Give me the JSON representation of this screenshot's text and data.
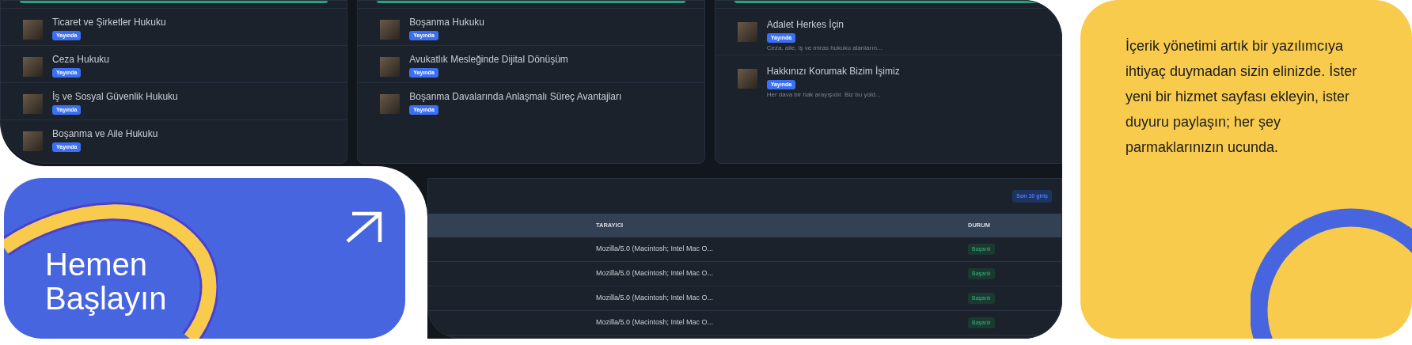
{
  "content_cards": [
    {
      "items": [
        {
          "title": "Ticaret ve Şirketler Hukuku",
          "status": "Yayında"
        },
        {
          "title": "Ceza Hukuku",
          "status": "Yayında"
        },
        {
          "title": "İş ve Sosyal Güvenlik Hukuku",
          "status": "Yayında"
        },
        {
          "title": "Boşanma ve Aile Hukuku",
          "status": "Yayında"
        }
      ]
    },
    {
      "items": [
        {
          "title": "Boşanma Hukuku",
          "status": "Yayında"
        },
        {
          "title": "Avukatlık Mesleğinde Dijital Dönüşüm",
          "status": "Yayında"
        },
        {
          "title": "Boşanma Davalarında Anlaşmalı Süreç Avantajları",
          "status": "Yayında"
        }
      ]
    },
    {
      "items": [
        {
          "title": "Adalet Herkes İçin",
          "status": "Yayında",
          "excerpt": "Ceza, aile, iş ve miras hukuku alanların..."
        },
        {
          "title": "Hakkınızı Korumak Bizim İşimiz",
          "status": "Yayında",
          "excerpt": "Her dava bir hak arayışıdır. Biz bu yold..."
        }
      ]
    }
  ],
  "login_table": {
    "badge": "Son 10 giriş",
    "columns": [
      "TARAYICI",
      "DURUM"
    ],
    "rows": [
      {
        "browser": "Mozilla/5.0 (Macintosh; Intel Mac O...",
        "status": "Başarılı"
      },
      {
        "browser": "Mozilla/5.0 (Macintosh; Intel Mac O...",
        "status": "Başarılı"
      },
      {
        "browser": "Mozilla/5.0 (Macintosh; Intel Mac O...",
        "status": "Başarılı"
      },
      {
        "browser": "Mozilla/5.0 (Macintosh; Intel Mac O...",
        "status": "Başarılı"
      }
    ]
  },
  "cta": {
    "label": "Hemen Başlayın"
  },
  "promo": {
    "text": "İçerik yönetimi artık bir yazılımcıya ihtiyaç duymadan sizin elinizde. İster yeni bir hizmet sayfası ekleyin, ister duyuru paylaşın; her şey parmaklarınızın ucunda."
  }
}
